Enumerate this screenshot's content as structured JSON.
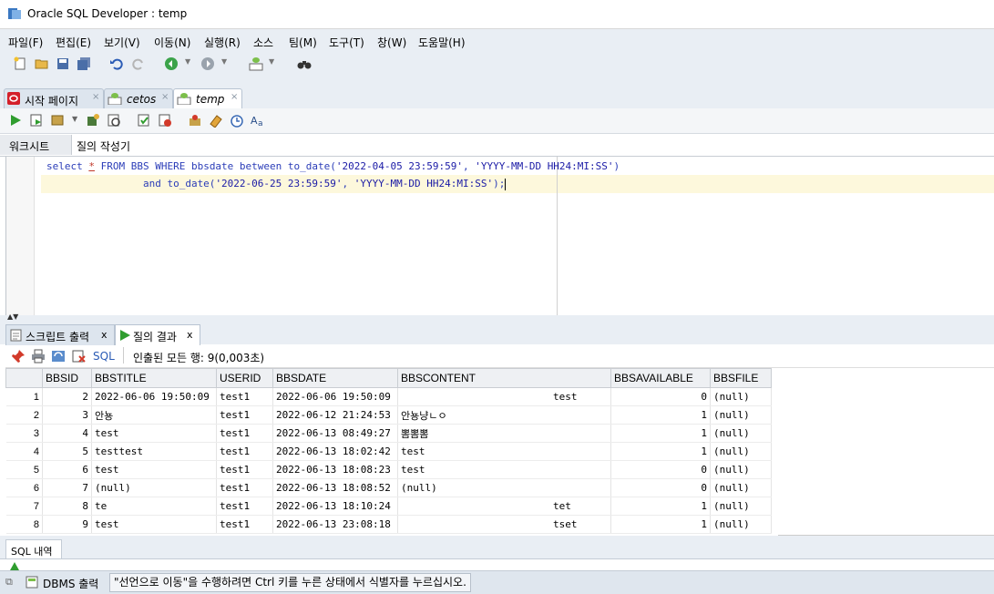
{
  "window": {
    "title": "Oracle SQL Developer : temp"
  },
  "menu": [
    "파일(F)",
    "편집(E)",
    "보기(V)",
    "이동(N)",
    "실행(R)",
    "소스",
    "팀(M)",
    "도구(T)",
    "창(W)",
    "도움말(H)"
  ],
  "doc_tabs": [
    {
      "label": "시작 페이지",
      "active": false
    },
    {
      "label": "cetos",
      "active": false
    },
    {
      "label": "temp",
      "active": true
    }
  ],
  "worksheet_tabs": [
    "워크시트",
    "질의 작성기"
  ],
  "editor": {
    "line1": {
      "p1": "select ",
      "p2": "*",
      "p3": " FROM BBS WHERE bbsdate between to_date(",
      "p4": "'2022-04-05 23:59:59'",
      "p5": ", ",
      "p6": "'YYYY-MM-DD HH24:MI:SS'",
      "p7": ")"
    },
    "line2": {
      "p1": "                and to_date(",
      "p2": "'2022-06-25 23:59:59'",
      "p3": ", ",
      "p4": "'YYYY-MM-DD HH24:MI:SS'",
      "p5": ");"
    }
  },
  "result_tabs": [
    {
      "label": "스크립트 출력",
      "close": "x",
      "active": false
    },
    {
      "label": "질의 결과",
      "close": "x",
      "active": true
    }
  ],
  "result_toolbar": {
    "sql_label": "SQL",
    "status": "인출된 모든 행: 9(0,003초)"
  },
  "grid": {
    "columns": [
      "BBSID",
      "BBSTITLE",
      "USERID",
      "BBSDATE",
      "BBSCONTENT",
      "BBSAVAILABLE",
      "BBSFILE"
    ],
    "rows": [
      {
        "n": "1",
        "bbsid": "2",
        "title": "2022-06-06 19:50:09",
        "userid": "test1",
        "date": "2022-06-06 19:50:09",
        "content": "test",
        "avail": "0",
        "file": "(null)"
      },
      {
        "n": "2",
        "bbsid": "3",
        "title": "안뇽",
        "userid": "test1",
        "date": "2022-06-12 21:24:53",
        "content": "안뇽냥ㄴㅇ",
        "avail": "1",
        "file": "(null)"
      },
      {
        "n": "3",
        "bbsid": "4",
        "title": "test",
        "userid": "test1",
        "date": "2022-06-13 08:49:27",
        "content": "뽐뽐뽐",
        "avail": "1",
        "file": "(null)"
      },
      {
        "n": "4",
        "bbsid": "5",
        "title": "testtest",
        "userid": "test1",
        "date": "2022-06-13 18:02:42",
        "content": "test",
        "avail": "1",
        "file": "(null)"
      },
      {
        "n": "5",
        "bbsid": "6",
        "title": "test",
        "userid": "test1",
        "date": "2022-06-13 18:08:23",
        "content": "test",
        "avail": "0",
        "file": "(null)"
      },
      {
        "n": "6",
        "bbsid": "7",
        "title": "(null)",
        "userid": "test1",
        "date": "2022-06-13 18:08:52",
        "content": "(null)",
        "avail": "0",
        "file": "(null)"
      },
      {
        "n": "7",
        "bbsid": "8",
        "title": "te",
        "userid": "test1",
        "date": "2022-06-13 18:10:24",
        "content": "tet",
        "avail": "1",
        "file": "(null)"
      },
      {
        "n": "8",
        "bbsid": "9",
        "title": "test",
        "userid": "test1",
        "date": "2022-06-13 23:08:18",
        "content": "tset",
        "avail": "1",
        "file": "(null)"
      }
    ]
  },
  "history_panel": {
    "label": "SQL 내역"
  },
  "status_bar": {
    "dbms_label": "DBMS 출력",
    "message": "\"선언으로 이동\"을 수행하려면 Ctrl 키를 누른 상태에서 식별자를 누르십시오."
  },
  "colors": {
    "chrome": "#e9eef4",
    "keyword": "#2b3db8",
    "current_line": "#fdf8dc"
  }
}
